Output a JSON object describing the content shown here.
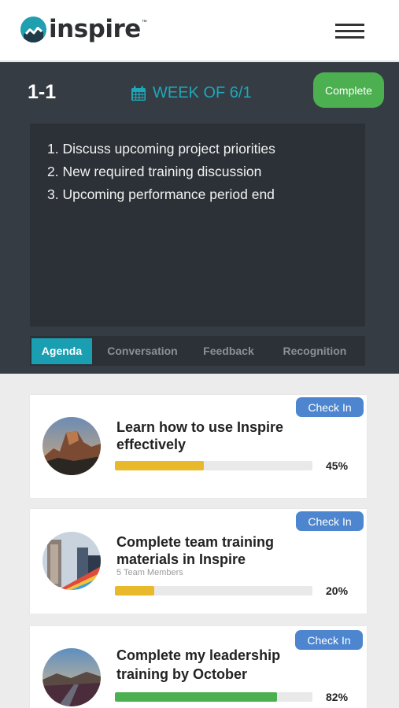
{
  "header": {
    "logo_text": "inspire",
    "logo_tm": "™",
    "menu_icon": "hamburger-menu-icon"
  },
  "meeting": {
    "title": "1-1",
    "week_label": "WEEK OF 6/1",
    "week_icon": "calendar-icon",
    "complete_label": "Complete",
    "agenda_items": [
      "1. Discuss upcoming project priorities",
      "2. New required training discussion",
      "3. Upcoming performance period end"
    ]
  },
  "tabs": [
    {
      "label": "Agenda",
      "active": true
    },
    {
      "label": "Conversation",
      "active": false
    },
    {
      "label": "Feedback",
      "active": false
    },
    {
      "label": "Recognition",
      "active": false
    }
  ],
  "goals": [
    {
      "title_line1": "Learn how to use Inspire",
      "title_line2": "effectively",
      "subtitle": "",
      "progress": 45,
      "progress_label": "45%",
      "checkin_label": "Check In",
      "bar_color": "#e8b92a"
    },
    {
      "title_line1": "Complete team training",
      "title_line2": "materials in Inspire",
      "subtitle": "5 Team Members",
      "progress": 20,
      "progress_label": "20%",
      "checkin_label": "Check In",
      "bar_color": "#e8b92a"
    },
    {
      "title_line1": "Complete my leadership",
      "title_line2": "training by October",
      "subtitle": "",
      "progress": 82,
      "progress_label": "82%",
      "checkin_label": "Check In",
      "bar_color": "#4caf50"
    }
  ],
  "colors": {
    "accent": "#1fa7b8",
    "dark_panel": "#363c43",
    "complete_green": "#4caf50",
    "checkin_blue": "#4d86cf"
  }
}
